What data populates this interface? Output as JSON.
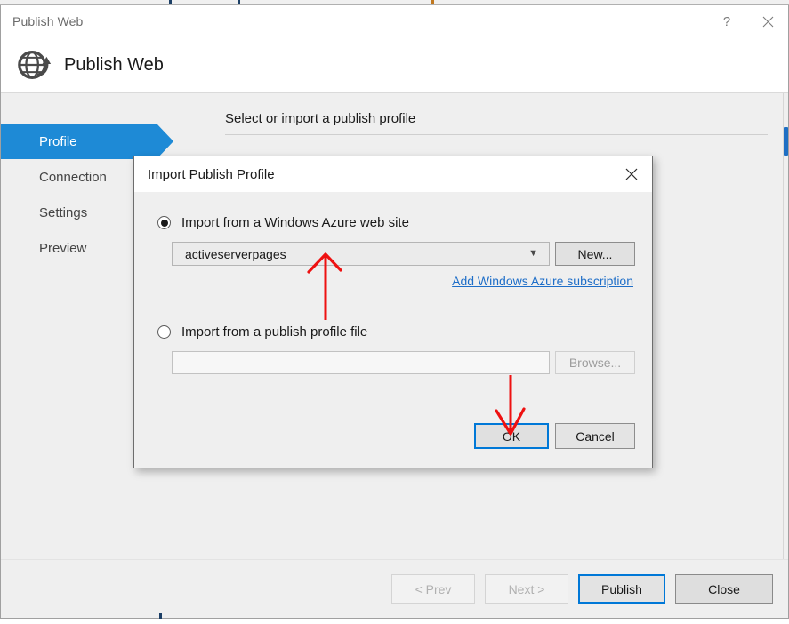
{
  "window": {
    "title": "Publish Web",
    "header_title": "Publish Web",
    "globe_icon": "globe-publish-icon",
    "help_icon": "question-mark-icon",
    "close_icon": "close-x-icon"
  },
  "sidebar": {
    "items": [
      {
        "label": "Profile",
        "active": true
      },
      {
        "label": "Connection",
        "active": false
      },
      {
        "label": "Settings",
        "active": false
      },
      {
        "label": "Preview",
        "active": false
      }
    ]
  },
  "main": {
    "page_heading": "Select or import a publish profile"
  },
  "footer": {
    "buttons": [
      {
        "label": "< Prev",
        "state": "disabled"
      },
      {
        "label": "Next >",
        "state": "disabled"
      },
      {
        "label": "Publish",
        "state": "default"
      },
      {
        "label": "Close",
        "state": "normal"
      }
    ]
  },
  "dialog": {
    "title": "Import Publish Profile",
    "close_icon": "close-x-icon",
    "azure_option": {
      "label": "Import from a Windows Azure web site",
      "selected": true,
      "combo_value": "activeserverpages",
      "combo_chevron": "chevron-down-icon",
      "new_button": "New...",
      "subscription_link": "Add Windows Azure subscription"
    },
    "file_option": {
      "label": "Import from a publish profile file",
      "selected": false,
      "path_value": "",
      "path_placeholder": "",
      "browse_button": "Browse..."
    },
    "ok_button": "OK",
    "cancel_button": "Cancel"
  },
  "annotations": [
    {
      "name": "arrow-pointing-at-combo",
      "direction": "up",
      "color": "#ee1111"
    },
    {
      "name": "arrow-pointing-at-ok",
      "direction": "down",
      "color": "#ee1111"
    }
  ],
  "colors": {
    "accent_blue": "#1e8ad6",
    "focus_blue": "#0078d7",
    "link_blue": "#1e6ec8",
    "annotation_red": "#ee1111",
    "window_bg": "#efefef"
  }
}
